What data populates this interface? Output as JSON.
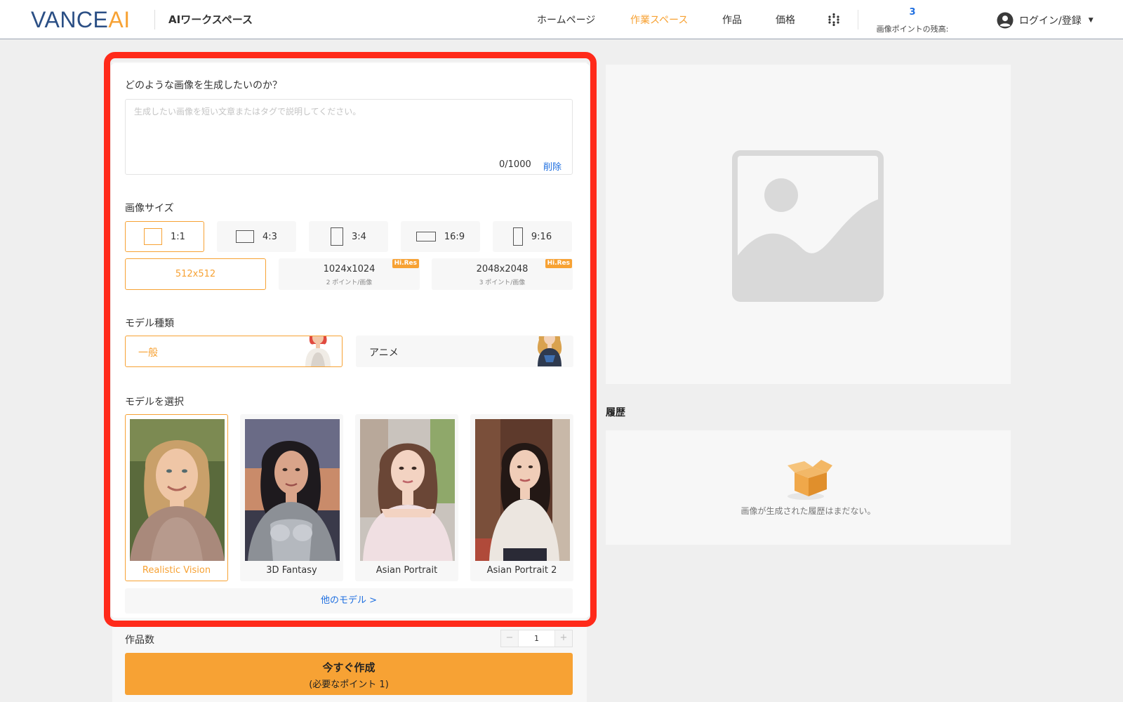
{
  "header": {
    "logo_vance": "VANCE",
    "logo_ai": "AI",
    "workspace_title": "AIワークスペース",
    "nav": [
      {
        "label": "ホームページ",
        "active": false
      },
      {
        "label": "作業スペース",
        "active": true
      },
      {
        "label": "作品",
        "active": false
      },
      {
        "label": "価格",
        "active": false
      }
    ],
    "apps_icon": "grid-dots-icon",
    "points_value": "3",
    "points_label": "画像ポイントの残高:",
    "login_label": "ログイン/登録"
  },
  "prompt": {
    "label": "どのような画像を生成したいのか？",
    "placeholder": "生成したい画像を短い文章またはタグで説明してください。",
    "value": "",
    "char_count": "0/1000",
    "clear_label": "削除"
  },
  "image_size": {
    "label": "画像サイズ",
    "ratios": [
      {
        "label": "1:1",
        "selected": true
      },
      {
        "label": "4:3",
        "selected": false
      },
      {
        "label": "3:4",
        "selected": false
      },
      {
        "label": "16:9",
        "selected": false
      },
      {
        "label": "9:16",
        "selected": false
      }
    ],
    "resolutions": [
      {
        "label": "512x512",
        "sub": "",
        "badge": "",
        "selected": true
      },
      {
        "label": "1024x1024",
        "sub": "2 ポイント/画像",
        "badge": "Hi.Res",
        "selected": false
      },
      {
        "label": "2048x2048",
        "sub": "3 ポイント/画像",
        "badge": "Hi.Res",
        "selected": false
      }
    ]
  },
  "model_type": {
    "label": "モデル種類",
    "options": [
      {
        "label": "一般",
        "selected": true
      },
      {
        "label": "アニメ",
        "selected": false
      }
    ]
  },
  "model_select": {
    "label": "モデルを選択",
    "models": [
      {
        "name": "Realistic Vision",
        "selected": true
      },
      {
        "name": "3D Fantasy",
        "selected": false
      },
      {
        "name": "Asian Portrait",
        "selected": false
      },
      {
        "name": "Asian Portrait 2",
        "selected": false
      }
    ],
    "more_label": "他のモデル >"
  },
  "quantity": {
    "label": "作品数",
    "minus": "−",
    "value": "1",
    "plus": "+"
  },
  "create_button": {
    "label": "今すぐ作成",
    "sub": "(必要なポイント 1)"
  },
  "history": {
    "title": "履歴",
    "empty_text": "画像が生成された履歴はまだない。"
  },
  "colors": {
    "accent": "#f7a234",
    "link": "#1f6fe0",
    "highlight_frame": "#ff2a1a",
    "logo_blue": "#2b4f85"
  }
}
